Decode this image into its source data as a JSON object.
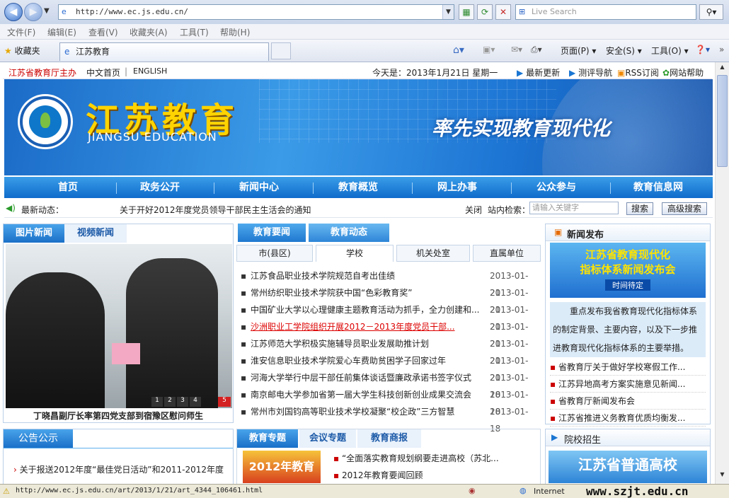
{
  "browser": {
    "url": "http://www.ec.js.edu.cn/",
    "live_search_placeholder": "Live Search",
    "menu": [
      "文件(F)",
      "编辑(E)",
      "查看(V)",
      "收藏夹(A)",
      "工具(T)",
      "帮助(H)"
    ],
    "favorites_label": "收藏夹",
    "tab_title": "江苏教育",
    "toolbar": {
      "page": "页面(P)",
      "safety": "安全(S)",
      "tools": "工具(O)"
    },
    "status_url": "http://www.ec.js.edu.cn/art/2013/1/21/art_4344_106461.html",
    "zone": "Internet",
    "watermark": "www.szjt.edu.cn"
  },
  "site": {
    "host": "江苏省教育厅主办",
    "home": "中文首页",
    "english": "ENGLISH",
    "date": "今天是：2013年1月21日 星期一",
    "top_links": [
      "最新更新",
      "测评导航",
      "RSS订阅",
      "网站帮助"
    ],
    "title_cn": "江苏教育",
    "title_en": "JIANGSU EDUCATION",
    "slogan": "率先实现教育现代化",
    "nav": [
      "首页",
      "政务公开",
      "新闻中心",
      "教育概览",
      "网上办事",
      "公众参与",
      "教育信息网"
    ],
    "latest_label": "最新动态：",
    "latest_news": "关于开好2012年度党员领导干部民主生活会的通知",
    "close": "关闭",
    "search_label": "站内检索：",
    "search_placeholder": "请输入关键字",
    "search_btn": "搜索",
    "adv_search_btn": "高级搜索"
  },
  "left": {
    "tabs": [
      "图片新闻",
      "视频新闻"
    ],
    "photo_pages": [
      "1",
      "2",
      "3",
      "4",
      "5"
    ],
    "photo_caption": "丁晓昌副厅长率第四党支部到宿豫区慰问师生",
    "notice_title": "公告公示",
    "notice_item": "关于报送2012年度“最佳党日活动”和2011-2012年度"
  },
  "center": {
    "tabs": [
      "教育要闻",
      "教育动态"
    ],
    "subtabs": [
      "市(县区)",
      "学校",
      "机关处室",
      "直属单位"
    ],
    "news": [
      {
        "title": "江苏食品职业技术学院规范自考出佳绩",
        "date": "2013-01-21"
      },
      {
        "title": "常州纺织职业技术学院获中国“色彩教育奖”",
        "date": "2013-01-21"
      },
      {
        "title": "中国矿业大学以心理健康主题教育活动为抓手，全力创建和...",
        "date": "2013-01-21"
      },
      {
        "title": "沙洲职业工学院组织开展2012－2013年度党员干部...",
        "date": "2013-01-21"
      },
      {
        "title": "江苏师范大学积极实施辅导员职业发展助推计划",
        "date": "2013-01-21"
      },
      {
        "title": "淮安信息职业技术学院爱心车费助贫困学子回家过年",
        "date": "2013-01-21"
      },
      {
        "title": "河海大学举行中层干部任前集体谈话暨廉政承诺书签字仪式",
        "date": "2013-01-18"
      },
      {
        "title": "南京邮电大学参加省第一届大学生科技创新创业成果交流会",
        "date": "2013-01-18"
      },
      {
        "title": "常州市刘国钧高等职业技术学校凝聚“校企政”三方智慧",
        "date": "2013-01-18"
      }
    ],
    "bottom_tabs": [
      "教育专题",
      "会议专题",
      "教育商报"
    ],
    "topic_img_text": "2012年教育",
    "topics": [
      "“全面落实教育规划纲要走进高校（苏北...",
      "2012年教育要闻回顾"
    ]
  },
  "right": {
    "press_title": "新闻发布",
    "press_banner_l1": "江苏省教育现代化",
    "press_banner_l2": "指标体系新闻发布会",
    "press_banner_l3": "时间待定",
    "press_desc": "重点发布我省教育现代化指标体系的制定背景、主要内容，以及下一步推进教育现代化指标体系的主要举措。",
    "items": [
      "省教育厅关于做好学校寒假工作...",
      "江苏异地高考方案实施意见新闻...",
      "省教育厅新闻发布会",
      "江苏省推进义务教育优质均衡发..."
    ],
    "admission_title": "院校招生",
    "admission_banner": "江苏省普通高校"
  }
}
